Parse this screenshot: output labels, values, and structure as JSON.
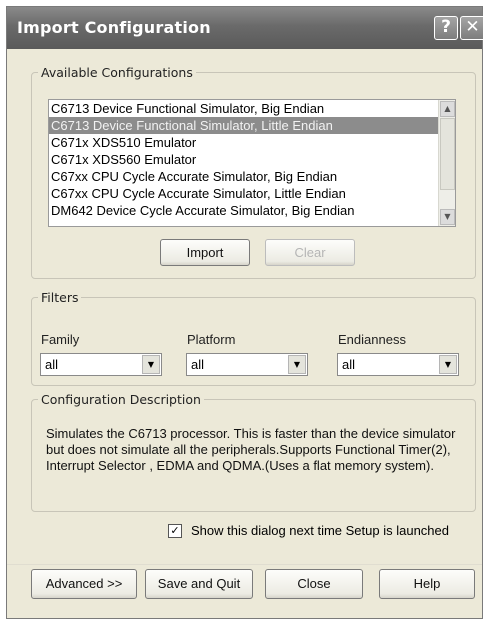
{
  "window": {
    "title": "Import Configuration",
    "help_button": "?",
    "close_button": "✕"
  },
  "available": {
    "legend": "Available Configurations",
    "items": [
      "C6713 Device Functional Simulator, Big Endian",
      "C6713 Device Functional Simulator, Little Endian",
      "C671x XDS510 Emulator",
      "C671x XDS560 Emulator",
      "C67xx CPU Cycle Accurate Simulator, Big Endian",
      "C67xx CPU Cycle Accurate Simulator, Little Endian",
      "DM642 Device Cycle Accurate Simulator, Big Endian"
    ],
    "selected_index": 1,
    "import_label": "Import",
    "clear_label": "Clear"
  },
  "filters": {
    "legend": "Filters",
    "family_label": "Family",
    "family_value": "all",
    "platform_label": "Platform",
    "platform_value": "all",
    "endianness_label": "Endianness",
    "endianness_value": "all"
  },
  "description": {
    "legend": "Configuration Description",
    "text": "Simulates the C6713 processor. This is faster than the device simulator but does not simulate all the peripherals.Supports Functional Timer(2), Interrupt Selector , EDMA and QDMA.(Uses a flat memory system)."
  },
  "show_dialog": {
    "checked": true,
    "label": "Show this dialog next time Setup is launched"
  },
  "buttons": {
    "advanced": "Advanced >>",
    "save_quit": "Save and Quit",
    "close": "Close",
    "help": "Help"
  }
}
